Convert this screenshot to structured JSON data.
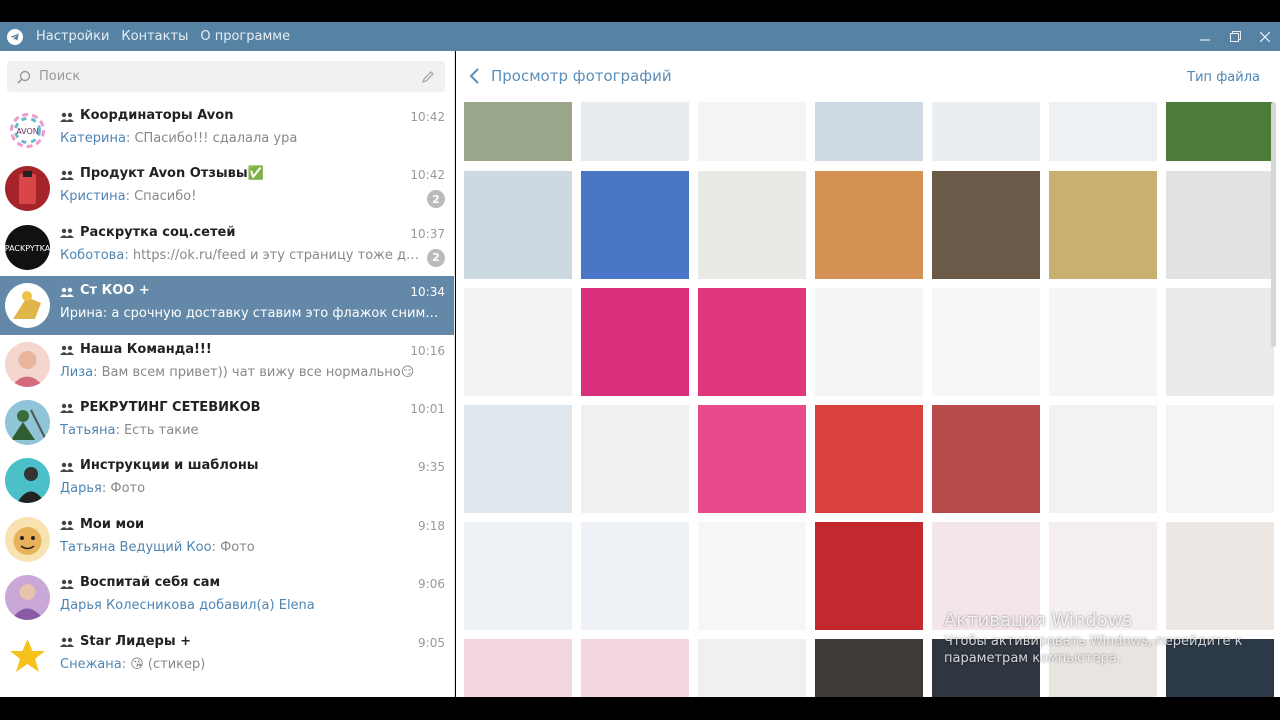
{
  "menu": [
    "Настройки",
    "Контакты",
    "О программе"
  ],
  "search": {
    "placeholder": "Поиск"
  },
  "chats": [
    {
      "title": "Координаторы Avon",
      "time": "10:42",
      "sender": "Катерина",
      "message": "СПасибо!!! сдалала ура",
      "badge": ""
    },
    {
      "title": "Продукт Avon Отзывы✅",
      "time": "10:42",
      "sender": "Кристина",
      "message": "Спасибо!",
      "badge": "2"
    },
    {
      "title": "Раскрутка соц.сетей",
      "time": "10:37",
      "sender": "Коботова",
      "message": "https://ok.ru/feed и эту страницу тоже добавляйте...",
      "badge": "2"
    },
    {
      "title": "Ст КОО +",
      "time": "10:34",
      "sender": "Ирина",
      "message": "а срочную доставку ставим это флажок снимаем с обыч...",
      "badge": ""
    },
    {
      "title": "Наша Команда!!!",
      "time": "10:16",
      "sender": "Лиза",
      "message": "Вам всем привет)) чат вижу все нормально😏",
      "badge": ""
    },
    {
      "title": "РЕКРУТИНГ СЕТЕВИКОВ",
      "time": "10:01",
      "sender": "Татьяна",
      "message": "Есть такие",
      "badge": ""
    },
    {
      "title": "Инструкции и шаблоны",
      "time": "9:35",
      "sender": "Дарья",
      "message": "Фото",
      "badge": ""
    },
    {
      "title": "Мои мои",
      "time": "9:18",
      "sender": "Татьяна Ведущий Коо",
      "message": "Фото",
      "badge": ""
    },
    {
      "title": "Воспитай себя сам",
      "time": "9:06",
      "sender": "",
      "message": "Дарья Колесникова добавил(а) Elena",
      "badge": ""
    },
    {
      "title": "Star Лидеры +",
      "time": "9:05",
      "sender": "Снежана",
      "message": "😘 (стикер)",
      "badge": ""
    }
  ],
  "main": {
    "title": "Просмотр фотографий",
    "file_type": "Тип файла"
  },
  "watermark": {
    "title": "Активация Windows",
    "text": "Чтобы активировать Windows, перейдите к параметрам компьютера."
  },
  "colors": {
    "titlebar": "#5682a3",
    "active_chat": "#6489a8",
    "accent": "#4e85b3"
  }
}
